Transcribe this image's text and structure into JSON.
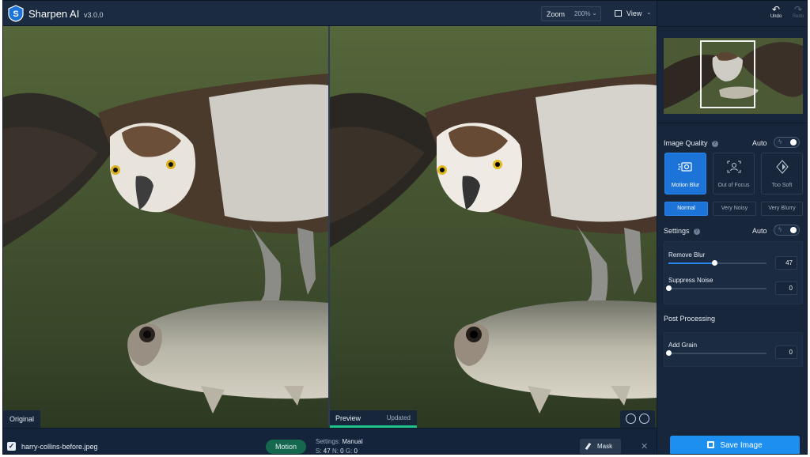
{
  "app": {
    "name": "Sharpen AI",
    "version": "v3.0.0"
  },
  "toolbar": {
    "zoom_label": "Zoom",
    "zoom_value": "200%",
    "view_label": "View",
    "undo_label": "Undo",
    "redo_label": "Redo"
  },
  "canvas": {
    "original_label": "Original",
    "preview_label": "Preview",
    "preview_status": "Updated"
  },
  "bottombar": {
    "filename": "harry-collins-before.jpeg",
    "mode": "Motion",
    "settings_label": "Settings:",
    "settings_value": "Manual",
    "s_label": "S:",
    "s_value": "47",
    "n_label": "N:",
    "n_value": "0",
    "g_label": "G:",
    "g_value": "0",
    "mask_label": "Mask"
  },
  "panel": {
    "image_quality": {
      "title": "Image Quality",
      "auto_label": "Auto",
      "auto_enabled": false,
      "models": [
        {
          "label": "Motion Blur",
          "icon": "motion-blur-icon",
          "active": true
        },
        {
          "label": "Out of Focus",
          "icon": "out-of-focus-icon",
          "active": false
        },
        {
          "label": "Too Soft",
          "icon": "too-soft-icon",
          "active": false
        }
      ],
      "variants": [
        {
          "label": "Normal",
          "active": true
        },
        {
          "label": "Very Noisy",
          "active": false
        },
        {
          "label": "Very Blurry",
          "active": false
        }
      ]
    },
    "settings": {
      "title": "Settings",
      "auto_label": "Auto",
      "auto_enabled": false,
      "sliders": [
        {
          "label": "Remove Blur",
          "value": "47",
          "level": 0.47
        },
        {
          "label": "Suppress Noise",
          "value": "0",
          "level": 0
        }
      ]
    },
    "post_processing": {
      "title": "Post Processing",
      "sliders": [
        {
          "label": "Add Grain",
          "value": "0",
          "level": 0
        }
      ]
    },
    "save_label": "Save Image"
  },
  "colors": {
    "background": "#17263a",
    "accent": "#1d74d8",
    "save": "#1d8fef",
    "mode_pill": "#13684d",
    "preview_underline": "#1ec28b"
  }
}
